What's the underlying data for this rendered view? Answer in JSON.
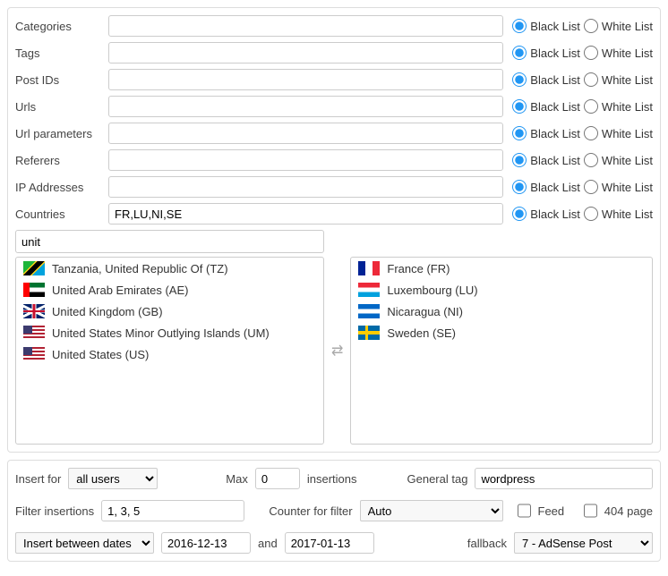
{
  "rows": [
    {
      "key": "categories",
      "label": "Categories",
      "value": "",
      "bl": true
    },
    {
      "key": "tags",
      "label": "Tags",
      "value": "",
      "bl": true
    },
    {
      "key": "postids",
      "label": "Post IDs",
      "value": "",
      "bl": true
    },
    {
      "key": "urls",
      "label": "Urls",
      "value": "",
      "bl": true
    },
    {
      "key": "urlparams",
      "label": "Url parameters",
      "value": "",
      "bl": true
    },
    {
      "key": "referers",
      "label": "Referers",
      "value": "",
      "bl": true
    },
    {
      "key": "ips",
      "label": "IP Addresses",
      "value": "",
      "bl": true
    },
    {
      "key": "countries",
      "label": "Countries",
      "value": "FR,LU,NI,SE",
      "bl": true
    }
  ],
  "listLabels": {
    "black": "Black List",
    "white": "White List"
  },
  "countryFilter": {
    "search": "unit"
  },
  "leftCountries": [
    {
      "flag": "tz",
      "name": "Tanzania, United Republic Of (TZ)"
    },
    {
      "flag": "ae",
      "name": "United Arab Emirates (AE)"
    },
    {
      "flag": "gb",
      "name": "United Kingdom (GB)"
    },
    {
      "flag": "us",
      "name": "United States Minor Outlying Islands (UM)"
    },
    {
      "flag": "us",
      "name": "United States (US)"
    }
  ],
  "rightCountries": [
    {
      "flag": "fr",
      "name": "France (FR)"
    },
    {
      "flag": "lu",
      "name": "Luxembourg (LU)"
    },
    {
      "flag": "ni",
      "name": "Nicaragua (NI)"
    },
    {
      "flag": "se",
      "name": "Sweden (SE)"
    }
  ],
  "bottom": {
    "insertForLabel": "Insert for",
    "insertFor": "all users",
    "maxLabel": "Max",
    "maxValue": "0",
    "insertionsLabel": "insertions",
    "generalTagLabel": "General tag",
    "generalTagValue": "wordpress",
    "filterInsertionsLabel": "Filter insertions",
    "filterInsertionsValue": "1, 3, 5",
    "counterLabel": "Counter for filter",
    "counterValue": "Auto",
    "feedLabel": "Feed",
    "notFoundLabel": "404 page",
    "datesSelect": "Insert between dates",
    "dateFrom": "2016-12-13",
    "andLabel": "and",
    "dateTo": "2017-01-13",
    "fallbackLabel": "fallback",
    "fallbackValue": "7 - AdSense Post"
  }
}
